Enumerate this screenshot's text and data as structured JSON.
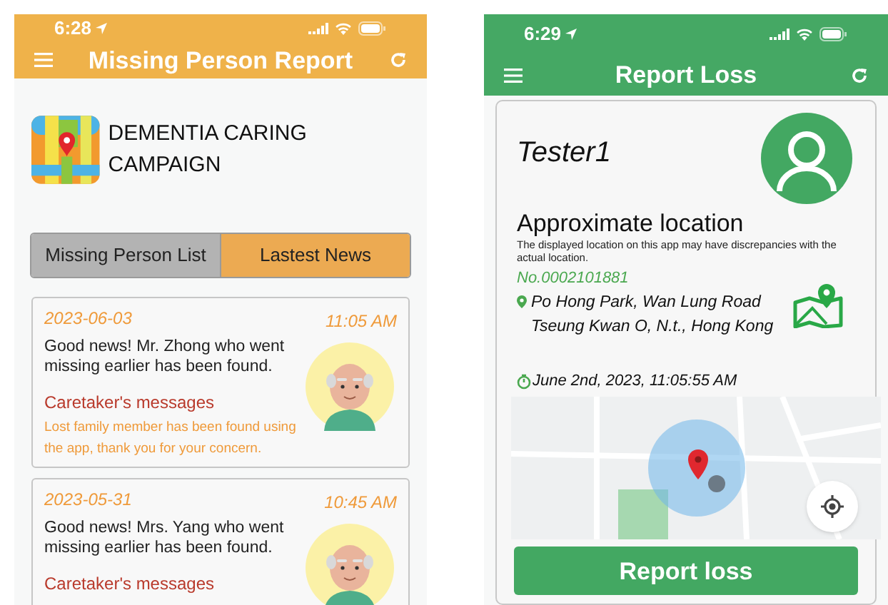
{
  "left_screen": {
    "status_bar": {
      "time": "6:28"
    },
    "header": {
      "title": "Missing Person Report"
    },
    "campaign": {
      "title": "DEMENTIA CARING CAMPAIGN"
    },
    "tabs": [
      {
        "label": "Missing Person List",
        "selected": false
      },
      {
        "label": "Lastest News",
        "selected": true
      }
    ],
    "news": [
      {
        "date": "2023-06-03",
        "time": "11:05 AM",
        "message": "Good news! Mr. Zhong who went missing earlier has been found.",
        "caretaker_heading": "Caretaker's messages",
        "caretaker_message": "Lost family member has been found using the app, thank you for your concern."
      },
      {
        "date": "2023-05-31",
        "time": "10:45 AM",
        "message": "Good news! Mrs. Yang who went missing earlier has been found.",
        "caretaker_heading": "Caretaker's messages"
      }
    ]
  },
  "right_screen": {
    "status_bar": {
      "time": "6:29"
    },
    "header": {
      "title": "Report Loss"
    },
    "profile": {
      "name": "Tester1"
    },
    "location": {
      "heading": "Approximate location",
      "disclaimer": "The displayed location on this app may have discrepancies with the actual location.",
      "number": "No.0002101881",
      "address_lines": [
        "Po Hong Park, Wan Lung Road",
        "Tseung Kwan O, N.t., Hong Kong"
      ],
      "timestamp": "June 2nd, 2023, 11:05:55 AM"
    },
    "button": {
      "label": "Report loss"
    }
  }
}
